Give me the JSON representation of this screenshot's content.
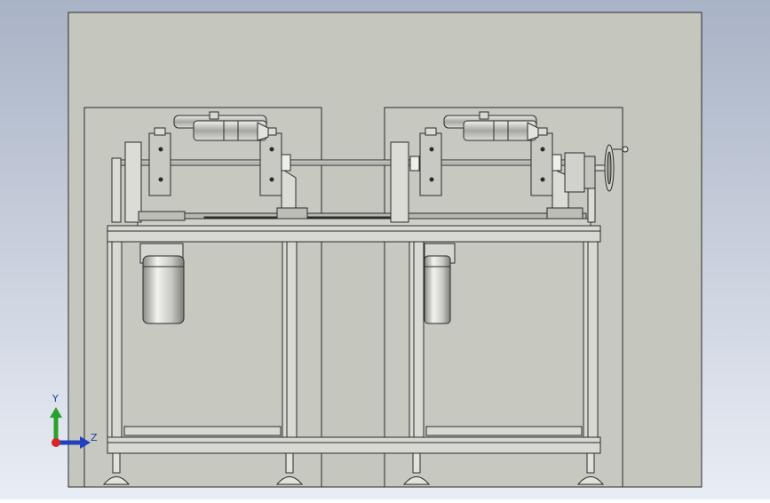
{
  "viewport": {
    "background_top": "#a9b3c6",
    "background_bottom": "#e9edf4",
    "sheet_color": "#c5c6be",
    "line_color": "#2b2b2b",
    "metal_light": "#e6e6e0",
    "metal_dark": "#7a7a76"
  },
  "triad": {
    "y_label": "Y",
    "z_label": "Z",
    "y_color": "#2ca02c",
    "z_color": "#1f3fbf",
    "x_color": "#d62728"
  }
}
